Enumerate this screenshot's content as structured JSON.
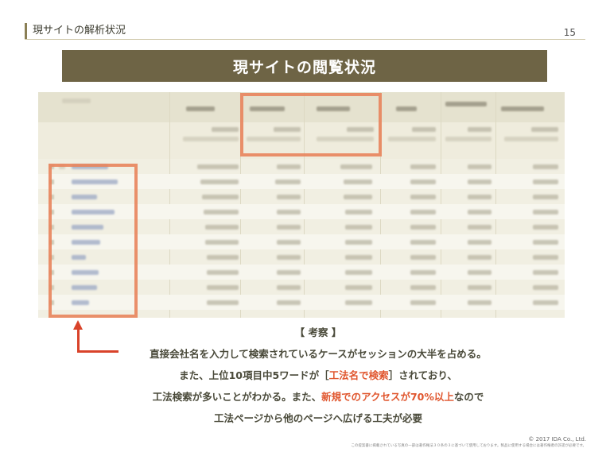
{
  "header": {
    "section_title": "現サイトの解析状況",
    "page_number": "15"
  },
  "title": "現サイトの閲覧状況",
  "analysis": {
    "heading": "【 考察 】",
    "line1": "直接会社名を入力して検索されているケースがセッションの大半を占める。",
    "line2_a": "また、上位10項目中5ワードが［",
    "line2_highlight": "工法名で検索",
    "line2_b": "］されており、",
    "line3_a": "工法検索が多いことがわかる。また、",
    "line3_highlight": "新規でのアクセスが70%以上",
    "line3_b": "なので",
    "line4": "工法ページから他のページへ広げる工夫が必要"
  },
  "footer": {
    "copyright": "© 2017 IDA Co., Ltd.",
    "notice": "この提案書に掲載されている写真の一部は著作権法３０条の３に基づいて使用しております。製品に使用する場合には著作権者の許諾が必要です。"
  },
  "colors": {
    "banner": "#6e6445",
    "highlight_box": "#e8845c",
    "arrow": "#d9432a",
    "accent_text": "#e0562e"
  },
  "icons": {
    "arrow": "arrow-up-left-icon"
  }
}
